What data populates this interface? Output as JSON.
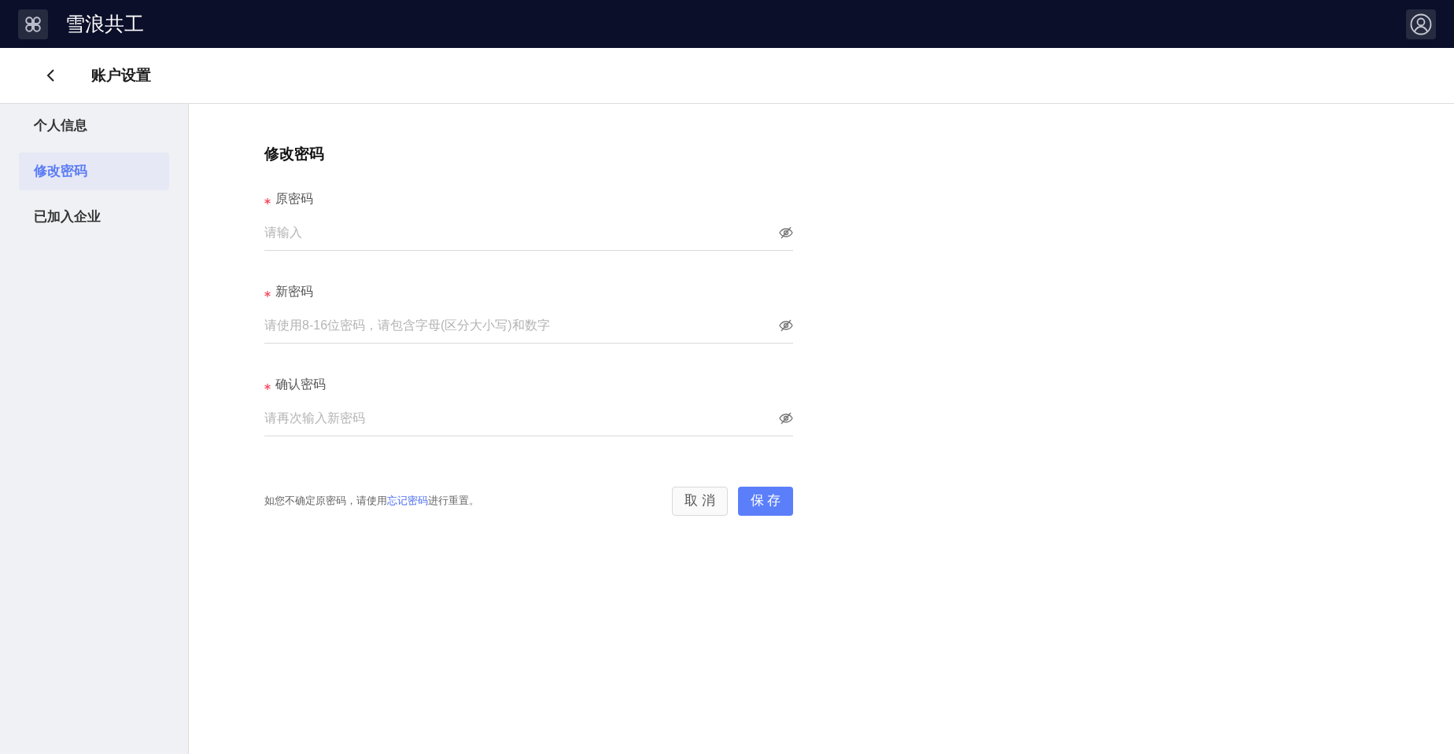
{
  "app": {
    "title": "雪浪共工"
  },
  "page": {
    "title": "账户设置"
  },
  "sidebar": {
    "items": [
      {
        "label": "个人信息",
        "selected": false
      },
      {
        "label": "修改密码",
        "selected": true
      },
      {
        "label": "已加入企业",
        "selected": false
      }
    ]
  },
  "form": {
    "title": "修改密码",
    "fields": [
      {
        "label": "原密码",
        "required": true,
        "placeholder": "请输入"
      },
      {
        "label": "新密码",
        "required": true,
        "placeholder": "请使用8-16位密码，请包含字母(区分大小写)和数字"
      },
      {
        "label": "确认密码",
        "required": true,
        "placeholder": "请再次输入新密码"
      }
    ],
    "hint": {
      "before": "如您不确定原密码，请使用",
      "link": "忘记密码",
      "after": "进行重置。"
    },
    "buttons": [
      {
        "label": "取 消",
        "kind": "secondary"
      },
      {
        "label": "保 存",
        "kind": "primary"
      }
    ]
  }
}
